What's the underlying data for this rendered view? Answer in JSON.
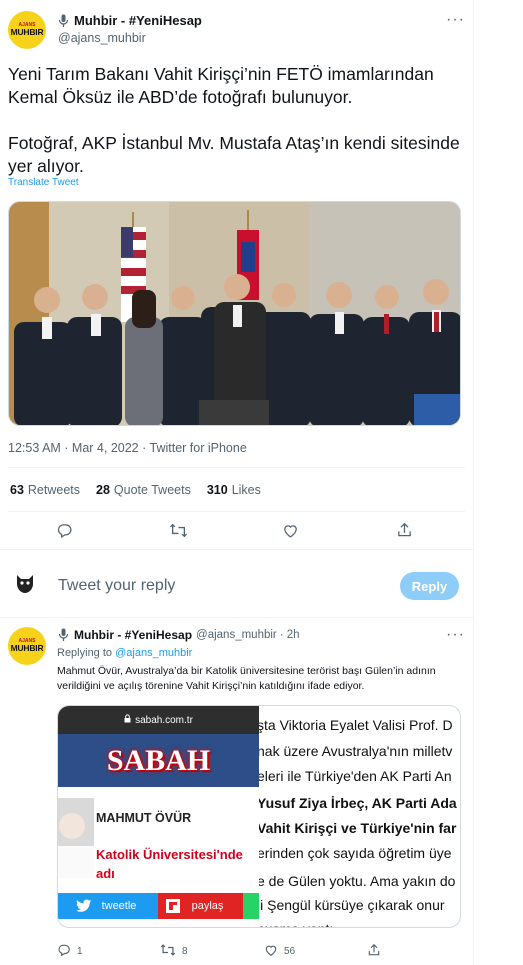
{
  "tweet": {
    "author_name": "Muhbir - #YeniHesap",
    "author_handle": "@ajans_muhbir",
    "avatar_small_text": "AJANS",
    "avatar_main_text": "MUHBIR",
    "text": "Yeni Tarım Bakanı Vahit Kirişçi’nin FETÖ imamlarından Kemal Öksüz ile ABD’de fotoğrafı bulunuyor.\n\nFotoğraf, AKP İstanbul Mv. Mustafa Ataş’ın kendi sitesinde yer alıyor.",
    "translate_label": "Translate Tweet",
    "more_label": "···",
    "timestamp": "12:53 AM · Mar 4, 2022 · Twitter for iPhone",
    "stats": {
      "retweets_count": "63",
      "retweets_label": "Retweets",
      "quotes_count": "28",
      "quotes_label": "Quote Tweets",
      "likes_count": "310",
      "likes_label": "Likes"
    }
  },
  "reply_box": {
    "placeholder": "Tweet your reply",
    "button_label": "Reply"
  },
  "reply": {
    "author_name": "Muhbir - #YeniHesap",
    "author_handle": "@ajans_muhbir",
    "time": "· 2h",
    "replying_label": "Replying to",
    "replying_handle": "@ajans_muhbir",
    "text": "Mahmut Övür, Avustralya’da bir Katolik üniversitesine terörist başı Gülen’in adının verildiğini ve açılış törenine Vahit Kirişçi’nin katıldığını ifade ediyor.",
    "more_label": "···",
    "image": {
      "url_text": "sabah.com.tr",
      "logo_text": "SABAH",
      "author_name": "MAHMUT ÖVÜR",
      "headline": "Katolik Üniversitesi'nde adı",
      "share_twitter": "tweetle",
      "share_flipboard": "paylaş",
      "article_lines": [
        "şta Viktoria Eyalet Valisi Prof. D",
        "nak üzere Avustralya'nın milletv",
        "eleri ile Türkiye'den AK Parti An",
        "Yusuf Ziya İrbeç, AK Parti Ada",
        "Vahit Kirişçi ve Türkiye'nin far",
        "erinden çok sayıda öğretim üye",
        "e de Gülen yoktu. Ama yakın do",
        "li Şengül kürsüye çıkarak onur",
        "nuşma yaptı."
      ]
    },
    "actions": {
      "replies": "1",
      "retweets": "8",
      "likes": "56"
    }
  },
  "colors": {
    "accent": "#1d9bf0",
    "reply_button_disabled": "#8ecdf8",
    "avatar_bg": "#f7d21b",
    "text_secondary": "#536471"
  },
  "icons": [
    "microphone-icon",
    "more-icon",
    "reply-icon",
    "retweet-icon",
    "like-icon",
    "share-icon",
    "lock-icon",
    "twitter-bird-icon",
    "flipboard-icon"
  ]
}
